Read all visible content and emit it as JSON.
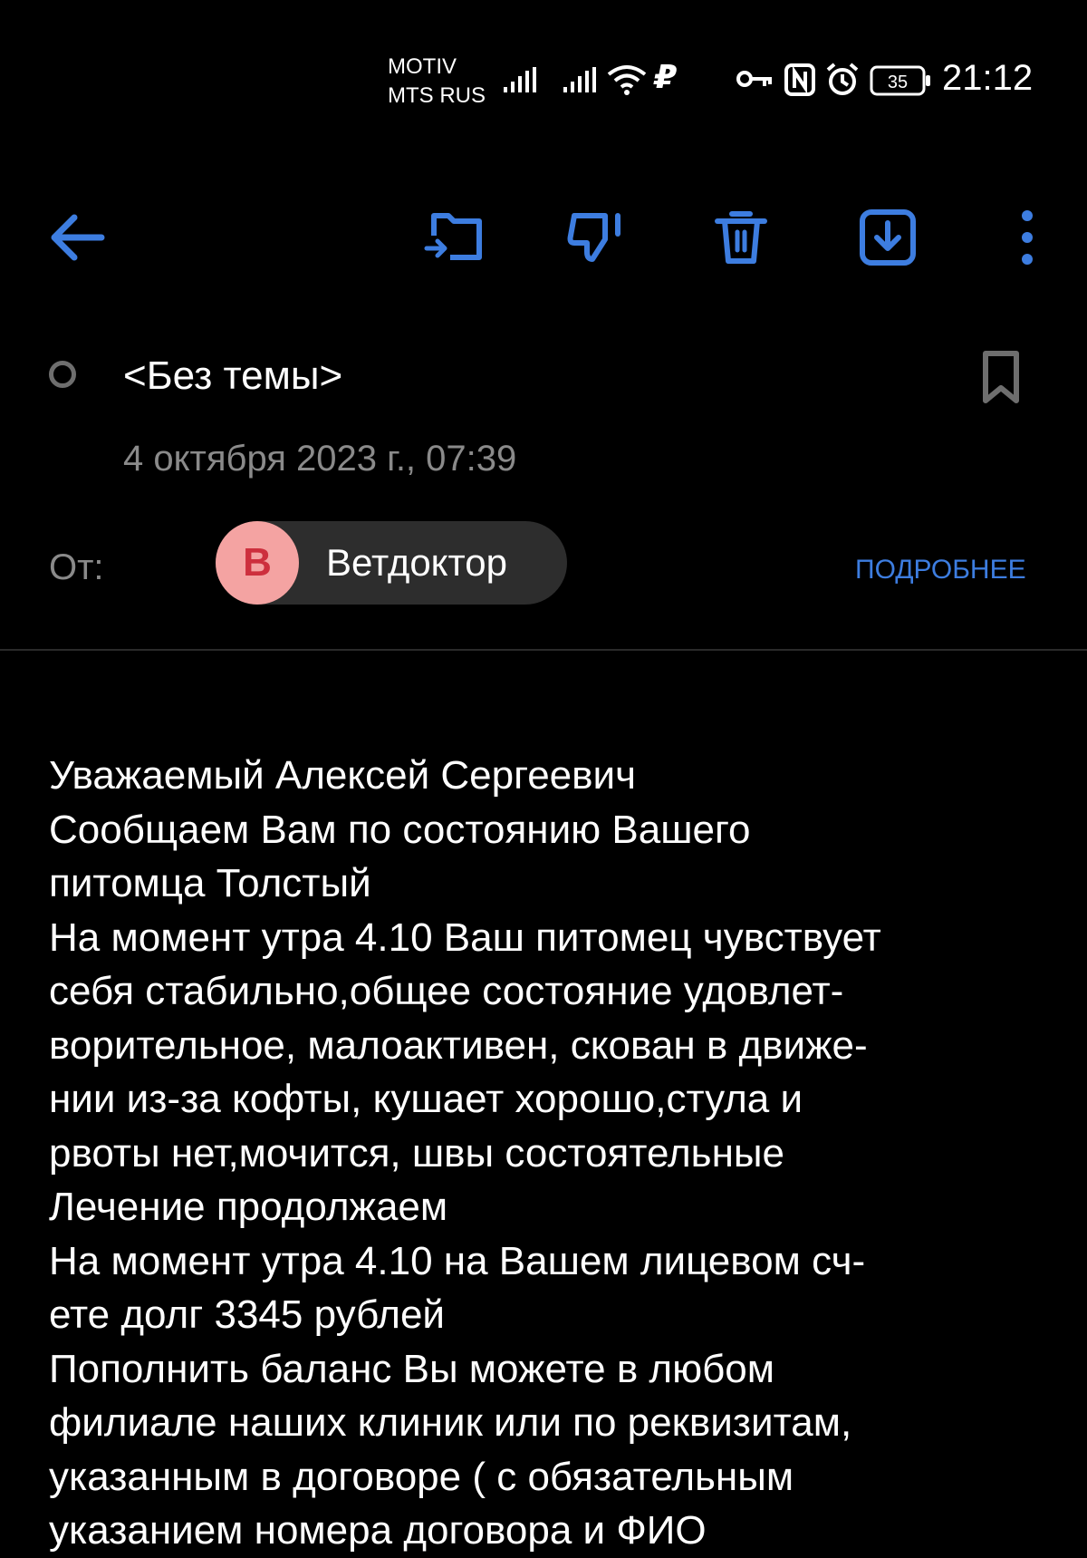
{
  "status_bar": {
    "carrier1": "MOTIV",
    "carrier2": "MTS RUS",
    "ruble_symbol": "₽",
    "battery": "35",
    "time": "21:12"
  },
  "toolbar": {
    "icons": [
      "back-arrow-icon",
      "move-to-folder-icon",
      "mark-spam-icon",
      "delete-icon",
      "download-icon",
      "more-options-icon"
    ],
    "accent_color": "#3d7de0"
  },
  "message": {
    "subject": "<Без темы>",
    "date": "4 октября 2023 г., 07:39",
    "from_label": "От:",
    "sender_initial": "В",
    "sender_name": "Ветдоктор",
    "details_label": "ПОДРОБНЕЕ",
    "body_lines": [
      "Уважаемый Алексей Сергеевич",
      "Сообщаем Вам по состоянию Вашего",
      "питомца Толстый",
      "На момент утра 4.10 Ваш питомец чувствует",
      "себя стабильно,общее состояние удовлет-",
      "ворительное, малоактивен, скован в движе-",
      "нии из-за кофты, кушает хорошо,стула и",
      "рвоты нет,мочится, швы состоятельные",
      "Лечение продолжаем",
      "На момент утра 4.10 на Вашем лицевом сч-",
      "ете долг 3345 рублей",
      "Пополнить баланс Вы можете в любом",
      "филиале наших клиник или по реквизитам,",
      "указанным в договоре ( с обязательным",
      "указанием номера договора и ФИО"
    ]
  }
}
